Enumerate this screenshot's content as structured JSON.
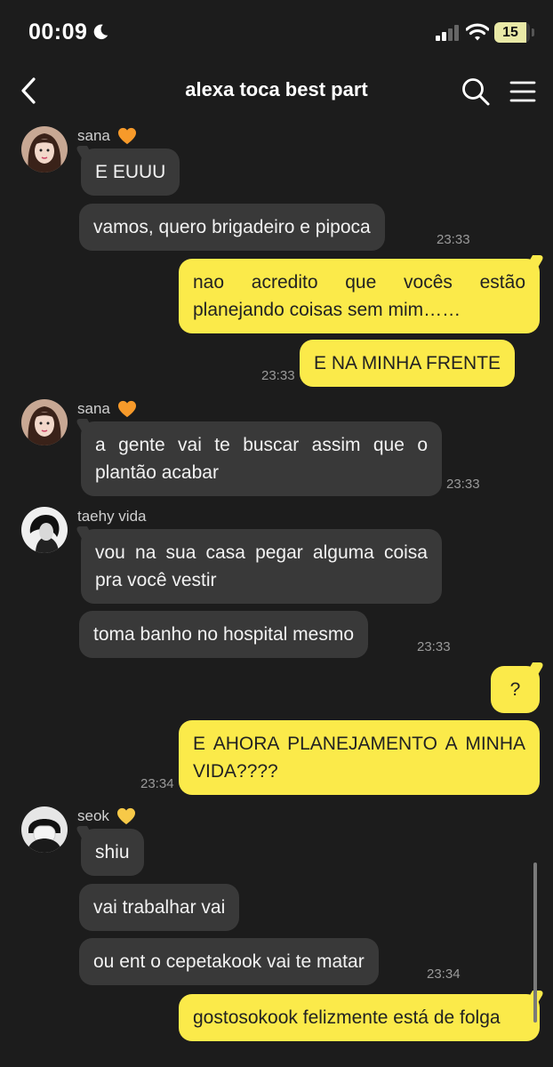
{
  "status_bar": {
    "time": "00:09",
    "battery_level": "15",
    "icons": [
      "moon-icon",
      "signal-icon",
      "wifi-icon",
      "battery-icon"
    ]
  },
  "header": {
    "title": "alexa toca best part",
    "icons": [
      "back-icon",
      "search-icon",
      "menu-icon"
    ]
  },
  "colors": {
    "background": "#1c1c1c",
    "incoming_bubble": "#393939",
    "outgoing_bubble": "#fbea4a",
    "heart_orange": "#f79a2a",
    "heart_yellow": "#f7c948"
  },
  "messages": [
    {
      "id": "m1",
      "sender": "sana",
      "direction": "in",
      "text": "E EUUU"
    },
    {
      "id": "m2",
      "sender": "sana",
      "direction": "in",
      "text": "vamos, quero brigadeiro e pipoca",
      "time": "23:33"
    },
    {
      "id": "m3",
      "direction": "out",
      "text": "nao acredito que vocês estão planejando coisas sem mim……"
    },
    {
      "id": "m4",
      "direction": "out",
      "text": "E NA MINHA FRENTE",
      "time": "23:33"
    },
    {
      "id": "m5",
      "sender": "sana",
      "direction": "in",
      "text": "a gente vai te buscar assim que o plantão acabar",
      "time": "23:33"
    },
    {
      "id": "m6",
      "sender": "taehy vida",
      "direction": "in",
      "text": "vou na sua casa pegar alguma coisa pra você vestir"
    },
    {
      "id": "m7",
      "sender": "taehy vida",
      "direction": "in",
      "text": "toma banho no hospital mesmo",
      "time": "23:33"
    },
    {
      "id": "m8",
      "direction": "out",
      "text": "?"
    },
    {
      "id": "m9",
      "direction": "out",
      "text": "E AHORA PLANEJAMENTO A MINHA VIDA????",
      "time": "23:34"
    },
    {
      "id": "m10",
      "sender": "seok",
      "direction": "in",
      "text": "shiu"
    },
    {
      "id": "m11",
      "sender": "seok",
      "direction": "in",
      "text": "vai trabalhar vai"
    },
    {
      "id": "m12",
      "sender": "seok",
      "direction": "in",
      "text": "ou ent o cepetakook vai te matar",
      "time": "23:34"
    },
    {
      "id": "m13",
      "direction": "out",
      "text": "gostosokook felizmente está de folga"
    }
  ],
  "senders": {
    "sana": {
      "name": "sana",
      "badge": "orange-heart-icon"
    },
    "taehy": {
      "name": "taehy vida"
    },
    "seok": {
      "name": "seok",
      "badge": "yellow-heart-icon"
    }
  }
}
